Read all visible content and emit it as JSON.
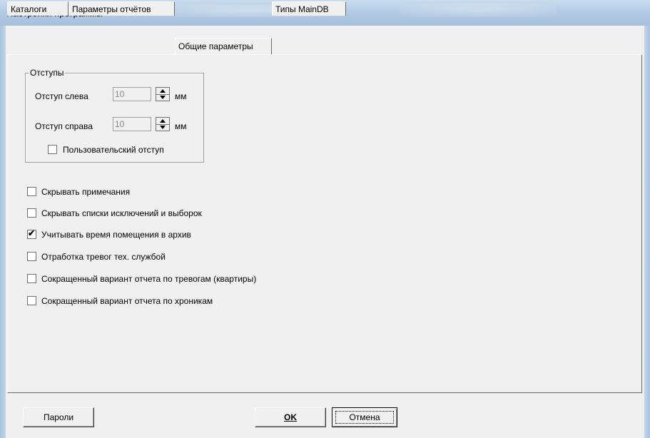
{
  "window": {
    "title": "Настройки программы"
  },
  "tabs": [
    {
      "label": "Каталоги"
    },
    {
      "label": "Параметры отчётов"
    },
    {
      "label": "Общие параметры"
    },
    {
      "label": "Типы MainDB"
    }
  ],
  "active_tab": "Общие параметры",
  "margins_group": {
    "title": "Отступы",
    "left": {
      "label": "Отступ слева",
      "value": "10",
      "unit": "мм"
    },
    "right": {
      "label": "Отступ справа",
      "value": "10",
      "unit": "мм"
    },
    "custom": {
      "label": "Пользовательский отступ",
      "checked": false
    }
  },
  "options": [
    {
      "label": "Скрывать примечания",
      "checked": false
    },
    {
      "label": "Скрывать списки исключений и выборок",
      "checked": false
    },
    {
      "label": "Учитывать время помещения в архив",
      "checked": true
    },
    {
      "label": "Отработка тревог тех. службой",
      "checked": false
    },
    {
      "label": "Сокращенный вариант отчета по тревогам (квартиры)",
      "checked": false
    },
    {
      "label": "Сокращенный вариант отчета по хроникам",
      "checked": false
    }
  ],
  "buttons": {
    "passwords": "Пароли",
    "ok": "OK",
    "cancel": "Отмена"
  },
  "checkmark": "✔"
}
